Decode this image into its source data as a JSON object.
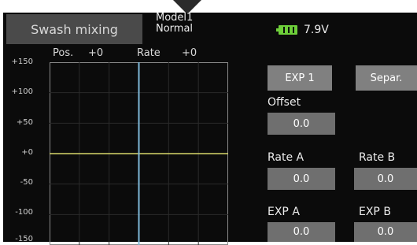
{
  "header": {
    "title": "Swash mixing",
    "model": "Model1",
    "condition": "Normal",
    "battery_voltage": "7.9V"
  },
  "chart_header": {
    "pos_label": "Pos.",
    "pos_value": "+0",
    "rate_label": "Rate",
    "rate_value": "+0"
  },
  "buttons": {
    "exp": "EXP 1",
    "separ": "Separ."
  },
  "fields": {
    "offset_label": "Offset",
    "offset_value": "0.0",
    "rate_a_label": "Rate A",
    "rate_a_value": "0.0",
    "rate_b_label": "Rate B",
    "rate_b_value": "0.0",
    "exp_a_label": "EXP A",
    "exp_a_value": "0.0",
    "exp_b_label": "EXP B",
    "exp_b_value": "0.0"
  },
  "chart_data": {
    "type": "line",
    "y_ticks": [
      "+150",
      "+100",
      "+50",
      "+0",
      "-50",
      "-100",
      "-150"
    ],
    "ylim": [
      -150,
      150
    ],
    "xlim": [
      -150,
      150
    ],
    "series": [
      {
        "points": [
          [
            -150,
            0
          ],
          [
            150,
            0
          ]
        ]
      }
    ],
    "cursor_x": 0,
    "grid": true
  },
  "colors": {
    "background": "#0b0b0b",
    "tab": "#4a4a4a",
    "button": "#808080",
    "field": "#6f6f6f",
    "curve": "#d8d86a",
    "cursor": "#7fb8d8",
    "battery": "#6ecf3a"
  }
}
